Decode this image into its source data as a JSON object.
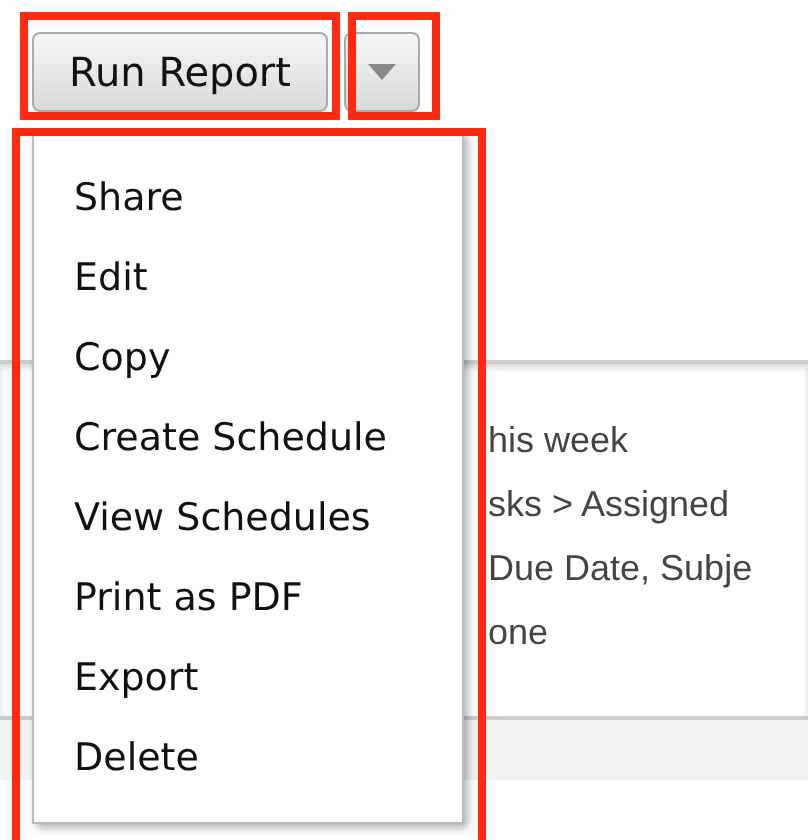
{
  "run_button": {
    "label": "Run Report"
  },
  "menu": {
    "items": [
      {
        "label": "Share"
      },
      {
        "label": "Edit"
      },
      {
        "label": "Copy"
      },
      {
        "label": "Create Schedule"
      },
      {
        "label": "View Schedules"
      },
      {
        "label": "Print as PDF"
      },
      {
        "label": "Export"
      },
      {
        "label": "Delete"
      }
    ]
  },
  "details": {
    "lines": [
      "his week",
      "sks > Assigned",
      "Due Date, Subje",
      "one"
    ]
  }
}
